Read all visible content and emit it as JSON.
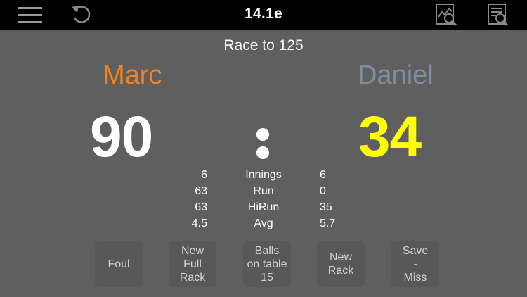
{
  "header": {
    "title": "14.1e",
    "icons": [
      "menu-icon",
      "undo-icon",
      "chart-icon",
      "report-icon"
    ]
  },
  "match": {
    "race_label": "Race to 125"
  },
  "player1": {
    "name": "Marc",
    "name_color": "#f58220",
    "score": "90",
    "score_color": "#ffffff",
    "innings": "6",
    "run": "63",
    "hirun": "63",
    "avg": "4.5"
  },
  "player2": {
    "name": "Daniel",
    "name_color": "#7f8da0",
    "score": "34",
    "score_color": "#ffff00",
    "innings": "6",
    "run": "0",
    "hirun": "35",
    "avg": "5.7"
  },
  "stat_labels": {
    "innings": "Innings",
    "run": "Run",
    "hirun": "HiRun",
    "avg": "Avg"
  },
  "separator": ":",
  "buttons": {
    "foul": "Foul",
    "new_full_rack": "New\nFull\nRack",
    "balls_on_table": "Balls\non table\n15",
    "new_rack": "New\nRack",
    "save_miss": "Save\n-\nMiss"
  }
}
